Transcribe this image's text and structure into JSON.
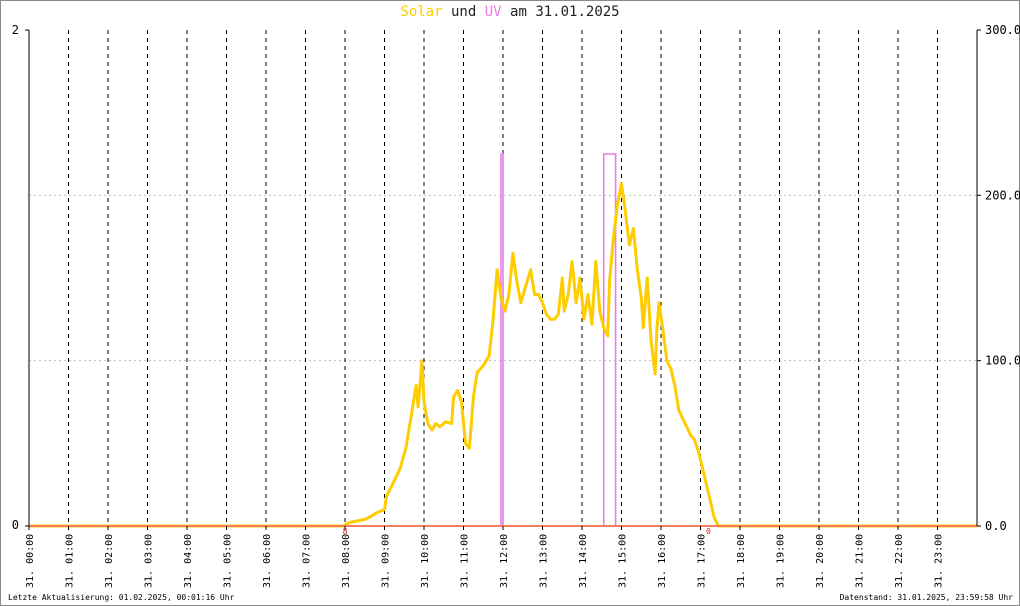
{
  "title": {
    "solar_label": "Solar",
    "und": "und",
    "uv_label": "UV",
    "am": "am",
    "date": "31.01.2025"
  },
  "footer": {
    "left": "Letzte Aktualisierung: 01.02.2025, 00:01:16 Uhr",
    "right": "Datenstand: 31.01.2025, 23:59:58 Uhr"
  },
  "colors": {
    "solar": "#ffcc00",
    "uv": "#e87ce8",
    "baseline": "#f08060",
    "grid": "#000000"
  },
  "chart_data": {
    "type": "line",
    "x_tick_labels": [
      "31. 00:00",
      "31. 01:00",
      "31. 02:00",
      "31. 03:00",
      "31. 04:00",
      "31. 05:00",
      "31. 06:00",
      "31. 07:00",
      "31. 08:00",
      "31. 09:00",
      "31. 10:00",
      "31. 11:00",
      "31. 12:00",
      "31. 13:00",
      "31. 14:00",
      "31. 15:00",
      "31. 16:00",
      "31. 17:00",
      "31. 18:00",
      "31. 19:00",
      "31. 20:00",
      "31. 21:00",
      "31. 22:00",
      "31. 23:00"
    ],
    "xlim": [
      0,
      24
    ],
    "y_left": {
      "lim": [
        0,
        2
      ],
      "tick_labels": [
        "0",
        "2"
      ]
    },
    "y_right": {
      "lim": [
        0,
        300
      ],
      "tick_labels": [
        "0.0",
        "100.0",
        "200.0",
        "300.0"
      ]
    },
    "markers": [
      {
        "x": 8.0,
        "label": "8"
      },
      {
        "x": 17.2,
        "label": "0"
      }
    ],
    "series": [
      {
        "axis": "right",
        "points": [
          [
            0,
            0
          ],
          [
            7.95,
            0
          ],
          [
            8.1,
            2
          ],
          [
            8.3,
            3
          ],
          [
            8.5,
            4
          ],
          [
            8.6,
            5
          ],
          [
            8.8,
            8
          ],
          [
            9.0,
            10
          ],
          [
            9.05,
            18
          ],
          [
            9.2,
            25
          ],
          [
            9.4,
            35
          ],
          [
            9.55,
            48
          ],
          [
            9.7,
            70
          ],
          [
            9.8,
            85
          ],
          [
            9.85,
            72
          ],
          [
            9.95,
            100
          ],
          [
            10.0,
            75
          ],
          [
            10.1,
            62
          ],
          [
            10.2,
            58
          ],
          [
            10.3,
            62
          ],
          [
            10.4,
            60
          ],
          [
            10.55,
            63
          ],
          [
            10.7,
            62
          ],
          [
            10.75,
            78
          ],
          [
            10.85,
            82
          ],
          [
            10.95,
            75
          ],
          [
            11.05,
            50
          ],
          [
            11.15,
            47
          ],
          [
            11.25,
            78
          ],
          [
            11.35,
            93
          ],
          [
            11.5,
            97
          ],
          [
            11.65,
            103
          ],
          [
            11.75,
            125
          ],
          [
            11.8,
            140
          ],
          [
            11.85,
            155
          ],
          [
            11.95,
            138
          ],
          [
            12.05,
            130
          ],
          [
            12.15,
            140
          ],
          [
            12.25,
            165
          ],
          [
            12.35,
            148
          ],
          [
            12.45,
            135
          ],
          [
            12.55,
            143
          ],
          [
            12.7,
            155
          ],
          [
            12.8,
            140
          ],
          [
            12.9,
            140
          ],
          [
            13.0,
            135
          ],
          [
            13.1,
            128
          ],
          [
            13.2,
            125
          ],
          [
            13.3,
            125
          ],
          [
            13.4,
            128
          ],
          [
            13.5,
            150
          ],
          [
            13.55,
            130
          ],
          [
            13.65,
            140
          ],
          [
            13.75,
            160
          ],
          [
            13.85,
            135
          ],
          [
            13.95,
            150
          ],
          [
            14.05,
            125
          ],
          [
            14.15,
            140
          ],
          [
            14.25,
            122
          ],
          [
            14.35,
            160
          ],
          [
            14.45,
            130
          ],
          [
            14.55,
            120
          ],
          [
            14.65,
            115
          ],
          [
            14.7,
            148
          ],
          [
            14.75,
            162
          ],
          [
            14.8,
            175
          ],
          [
            14.9,
            195
          ],
          [
            15.0,
            207
          ],
          [
            15.1,
            190
          ],
          [
            15.2,
            170
          ],
          [
            15.3,
            180
          ],
          [
            15.4,
            155
          ],
          [
            15.5,
            138
          ],
          [
            15.55,
            120
          ],
          [
            15.65,
            150
          ],
          [
            15.75,
            112
          ],
          [
            15.85,
            92
          ],
          [
            15.9,
            120
          ],
          [
            15.95,
            135
          ],
          [
            16.05,
            118
          ],
          [
            16.15,
            100
          ],
          [
            16.25,
            95
          ],
          [
            16.35,
            85
          ],
          [
            16.45,
            70
          ],
          [
            16.55,
            65
          ],
          [
            16.65,
            60
          ],
          [
            16.75,
            55
          ],
          [
            16.85,
            52
          ],
          [
            16.95,
            45
          ],
          [
            17.05,
            35
          ],
          [
            17.15,
            25
          ],
          [
            17.25,
            15
          ],
          [
            17.35,
            5
          ],
          [
            17.45,
            0
          ],
          [
            24,
            0
          ]
        ]
      },
      {
        "axis": "left",
        "points": [
          [
            0,
            0
          ],
          [
            11.95,
            0
          ],
          [
            11.95,
            1.5
          ],
          [
            12.0,
            1.5
          ],
          [
            12.0,
            0
          ],
          [
            14.55,
            0
          ],
          [
            14.55,
            1.5
          ],
          [
            14.85,
            1.5
          ],
          [
            14.85,
            0
          ],
          [
            24,
            0
          ]
        ]
      }
    ]
  }
}
